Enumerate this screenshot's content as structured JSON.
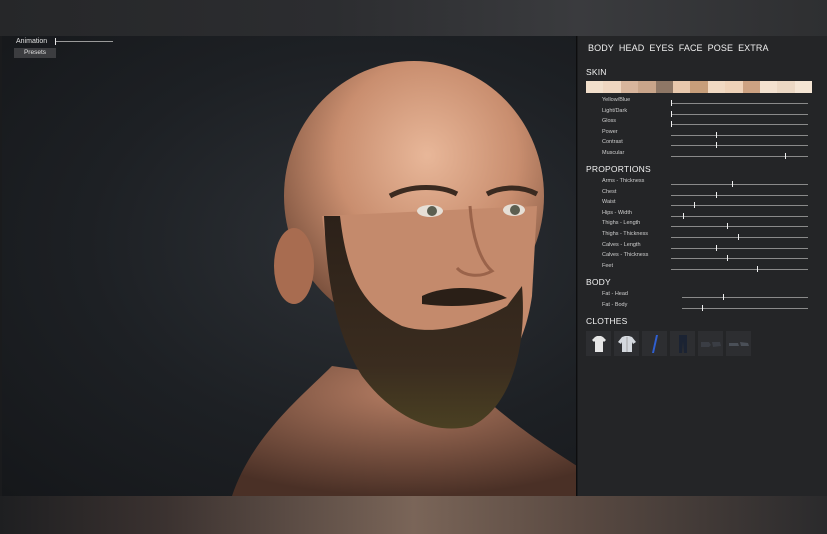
{
  "viewport": {
    "animation_label": "Animation",
    "animation_value": 0,
    "presets_label": "Presets"
  },
  "tabs": [
    "BODY",
    "HEAD",
    "EYES",
    "FACE",
    "POSE",
    "EXTRA"
  ],
  "skin": {
    "title": "SKIN",
    "swatch_colors": [
      "#f2dfcb",
      "#efd6c0",
      "#d8b59c",
      "#c9a58a",
      "#8e7766",
      "#e8c8ad",
      "#c79e7a",
      "#f1d9c2",
      "#efd2b8",
      "#cda282",
      "#f3e1cf",
      "#ecd8c4",
      "#f5e5d4"
    ],
    "sliders": [
      {
        "label": "Yellow/Blue",
        "value": 0.0
      },
      {
        "label": "Light/Dark",
        "value": 0.0
      },
      {
        "label": "Gloss",
        "value": 0.0
      },
      {
        "label": "Power",
        "value": 0.33
      },
      {
        "label": "Contrast",
        "value": 0.33
      },
      {
        "label": "Muscular",
        "value": 0.84
      }
    ]
  },
  "proportions": {
    "title": "PROPORTIONS",
    "sliders": [
      {
        "label": "Arms - Thickness",
        "value": 0.45
      },
      {
        "label": "Chest",
        "value": 0.33
      },
      {
        "label": "Waist",
        "value": 0.17
      },
      {
        "label": "Hips - Width",
        "value": 0.09
      },
      {
        "label": "Thighs - Length",
        "value": 0.41
      },
      {
        "label": "Thighs - Thickness",
        "value": 0.49
      },
      {
        "label": "Calves - Length",
        "value": 0.33
      },
      {
        "label": "Calves - Thickness",
        "value": 0.41
      },
      {
        "label": "Feet",
        "value": 0.63
      }
    ]
  },
  "body": {
    "title": "BODY",
    "sliders": [
      {
        "label": "Fat - Head",
        "value": 0.33
      },
      {
        "label": "Fat - Body",
        "value": 0.16
      }
    ]
  },
  "clothes": {
    "title": "CLOTHES",
    "items": [
      "tshirt-icon",
      "jacket-icon",
      "blue-strap-icon",
      "pants-icon",
      "boots-icon",
      "shoes-icon"
    ]
  }
}
